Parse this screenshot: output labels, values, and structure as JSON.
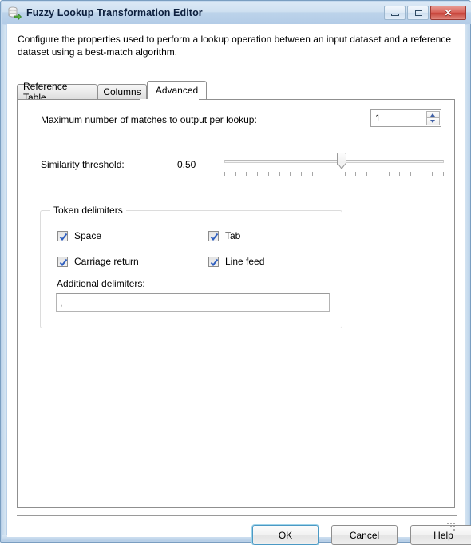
{
  "window": {
    "title": "Fuzzy Lookup Transformation Editor",
    "icon": "fuzzy-lookup-transformation-icon",
    "controls": {
      "minimize_label": "Minimize",
      "maximize_label": "Maximize",
      "close_label": "✕"
    }
  },
  "description": "Configure the properties used to perform a lookup operation between an input dataset and a reference dataset using a best-match algorithm.",
  "tabs": [
    {
      "label": "Reference Table",
      "active": false
    },
    {
      "label": "Columns",
      "active": false
    },
    {
      "label": "Advanced",
      "active": true
    }
  ],
  "advanced": {
    "max_matches": {
      "label": "Maximum number of matches to output per lookup:",
      "value": "1"
    },
    "similarity": {
      "label": "Similarity threshold:",
      "value": "0.50",
      "slider_min": 0,
      "slider_max": 1,
      "slider_value": 0.5,
      "tick_count": 21
    },
    "token_delimiters": {
      "title": "Token delimiters",
      "checkboxes": [
        {
          "label": "Space",
          "checked": true
        },
        {
          "label": "Tab",
          "checked": true
        },
        {
          "label": "Carriage return",
          "checked": true
        },
        {
          "label": "Line feed",
          "checked": true
        }
      ],
      "additional": {
        "label": "Additional delimiters:",
        "value": ",",
        "placeholder": ""
      }
    }
  },
  "footer": {
    "ok_label": "OK",
    "cancel_label": "Cancel",
    "help_label": "Help"
  },
  "colors": {
    "accent": "#4b99c4",
    "titlebar": "#c5d9ee",
    "close_button": "#c64339",
    "check_mark": "#2f5fbf"
  }
}
